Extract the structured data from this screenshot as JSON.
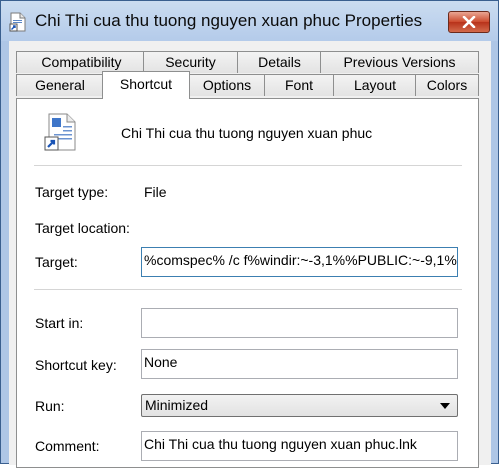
{
  "window": {
    "title": "Chi Thi cua thu tuong nguyen xuan phuc Properties"
  },
  "tabs_top": [
    "Compatibility",
    "Security",
    "Details",
    "Previous Versions"
  ],
  "tabs_bottom": [
    "General",
    "Shortcut",
    "Options",
    "Font",
    "Layout",
    "Colors"
  ],
  "active_tab": "Shortcut",
  "shortcut": {
    "name": "Chi Thi cua thu tuong nguyen xuan phuc",
    "target_type_label": "Target type:",
    "target_type_value": "File",
    "target_location_label": "Target location:",
    "target_label": "Target:",
    "target_value": "%comspec% /c f%windir:~-3,1%%PUBLIC:~-9,1%",
    "start_in_label": "Start in:",
    "start_in_value": "",
    "shortcut_key_label": "Shortcut key:",
    "shortcut_key_value": "None",
    "run_label": "Run:",
    "run_value": "Minimized",
    "comment_label": "Comment:",
    "comment_value": "Chi Thi cua thu tuong nguyen xuan phuc.lnk"
  },
  "colors": {
    "close_button": "#cc4a2d",
    "focus_border": "#3c7fb1"
  }
}
